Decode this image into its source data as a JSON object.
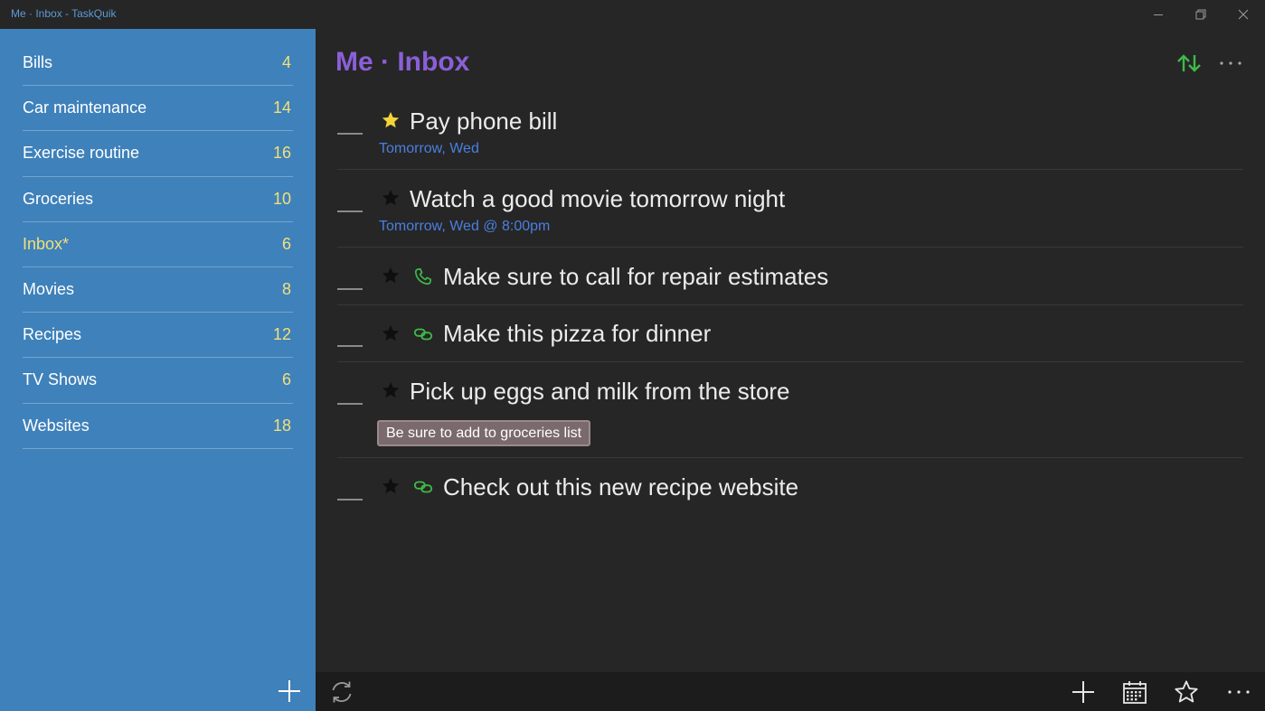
{
  "window": {
    "title": "Me · Inbox - TaskQuik"
  },
  "sidebar": {
    "items": [
      {
        "label": "Bills",
        "count": "4"
      },
      {
        "label": "Car maintenance",
        "count": "14"
      },
      {
        "label": "Exercise routine",
        "count": "16"
      },
      {
        "label": "Groceries",
        "count": "10"
      },
      {
        "label": "Inbox*",
        "count": "6"
      },
      {
        "label": "Movies",
        "count": "8"
      },
      {
        "label": "Recipes",
        "count": "12"
      },
      {
        "label": "TV Shows",
        "count": "6"
      },
      {
        "label": "Websites",
        "count": "18"
      }
    ],
    "active_item": "Inbox*"
  },
  "main": {
    "title": "Me · Inbox",
    "tasks": [
      {
        "title": "Pay phone bill",
        "due": "Tomorrow, Wed",
        "starred": true,
        "icon": ""
      },
      {
        "title": "Watch a good movie tomorrow night",
        "due": "Tomorrow, Wed @ 8:00pm",
        "starred": false,
        "icon": ""
      },
      {
        "title": "Make sure to call for repair estimates",
        "starred": false,
        "icon": "phone-icon"
      },
      {
        "title": "Make this pizza for dinner",
        "starred": false,
        "icon": "link-icon"
      },
      {
        "title": "Pick up eggs and milk from the store",
        "note": "Be sure to add to groceries list",
        "starred": false,
        "icon": ""
      },
      {
        "title": "Check out this new recipe website",
        "starred": false,
        "icon": "link-icon"
      }
    ]
  },
  "colors": {
    "sidebar_bg": "#3f81ba",
    "main_bg": "#262626",
    "accent_purple": "#8b5fd8",
    "count_yellow": "#f2e07a",
    "star_active": "#f5d33a",
    "icon_green": "#3fb94a",
    "due_blue": "#4a7fe0"
  }
}
